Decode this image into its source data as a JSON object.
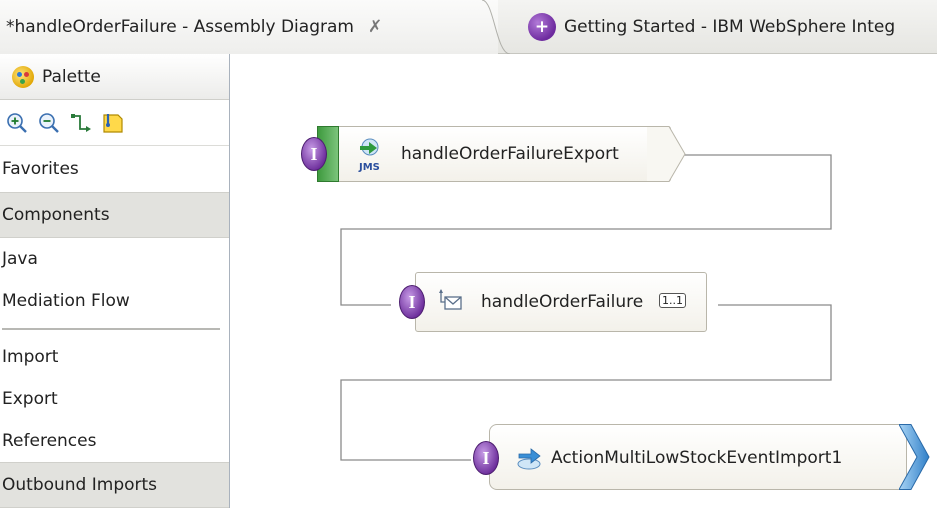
{
  "tabs": {
    "active_label": "*handleOrderFailure - Assembly Diagram",
    "close_glyph": "✗",
    "inactive_icon_glyph": "+",
    "inactive_label": "Getting Started - IBM WebSphere Integ"
  },
  "palette": {
    "title": "Palette",
    "tools": [
      {
        "name": "zoom-in-icon"
      },
      {
        "name": "zoom-out-icon"
      },
      {
        "name": "connection-icon"
      },
      {
        "name": "note-icon"
      }
    ],
    "drawers": {
      "favorites": "Favorites",
      "components": "Components",
      "outbound_imports": "Outbound Imports"
    },
    "items": {
      "java": "Java",
      "mediation_flow": "Mediation Flow",
      "import": "Import",
      "export": "Export",
      "references": "References"
    }
  },
  "diagram": {
    "export_node": {
      "label": "handleOrderFailureExport",
      "binding_icon": "JMS",
      "interface_glyph": "I"
    },
    "component_node": {
      "label": "handleOrderFailure",
      "reference_badge": "1..1",
      "interface_glyph": "I"
    },
    "import_node": {
      "label": "ActionMultiLowStockEventImport1",
      "interface_glyph": "I"
    }
  },
  "colors": {
    "interface_purple": "#6b2c9a",
    "export_green": "#5fae5f",
    "import_blue": "#3a8fd6",
    "wire_grey": "#8a8a8a"
  }
}
